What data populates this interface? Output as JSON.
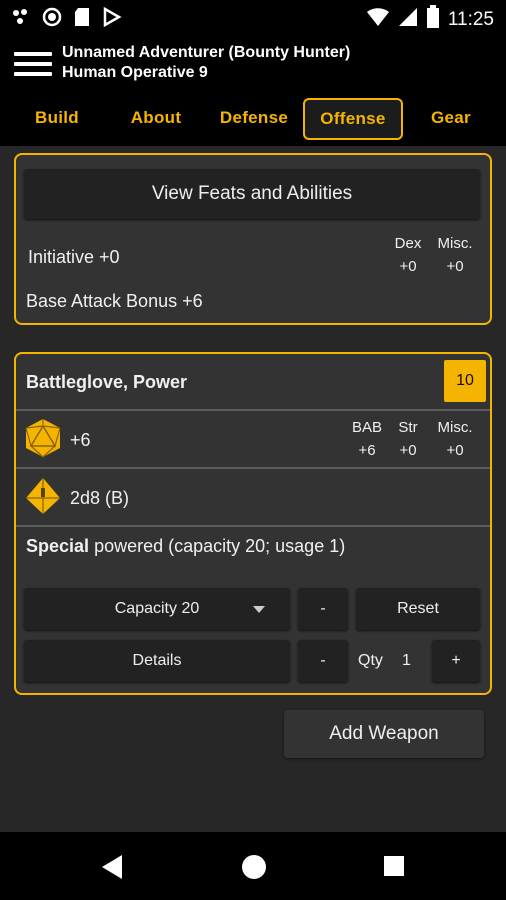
{
  "status_bar": {
    "time": "11:25"
  },
  "app_bar": {
    "title": "Unnamed Adventurer (Bounty Hunter)",
    "subtitle": "Human Operative 9"
  },
  "tabs": [
    {
      "label": "Build"
    },
    {
      "label": "About"
    },
    {
      "label": "Defense"
    },
    {
      "label": "Offense"
    },
    {
      "label": "Gear"
    }
  ],
  "summary": {
    "view_feats_label": "View Feats and Abilities",
    "initiative_label": "Initiative +0",
    "dex_header": "Dex",
    "dex_value": "+0",
    "misc_header": "Misc.",
    "misc_value": "+0",
    "bab_label": "Base Attack Bonus +6"
  },
  "weapon": {
    "name": "Battleglove, Power",
    "level": "10",
    "attack_bonus": "+6",
    "bab_header": "BAB",
    "bab_value": "+6",
    "str_header": "Str",
    "str_value": "+0",
    "misc_header": "Misc.",
    "misc_value": "+0",
    "damage": "2d8 (B)",
    "special_label": "Special",
    "special_text": "powered (capacity 20; usage 1)",
    "capacity_select": "Capacity 20",
    "minus_label": "-",
    "reset_label": "Reset",
    "details_label": "Details",
    "qty_label": "Qty",
    "qty_value": "1",
    "plus_label": "+"
  },
  "add_weapon_label": "Add Weapon",
  "accent_color": "#f5b400",
  "icons": [
    "d20-icon",
    "d4-icon",
    "back-icon",
    "home-icon",
    "recents-icon",
    "hamburger-menu-icon"
  ]
}
